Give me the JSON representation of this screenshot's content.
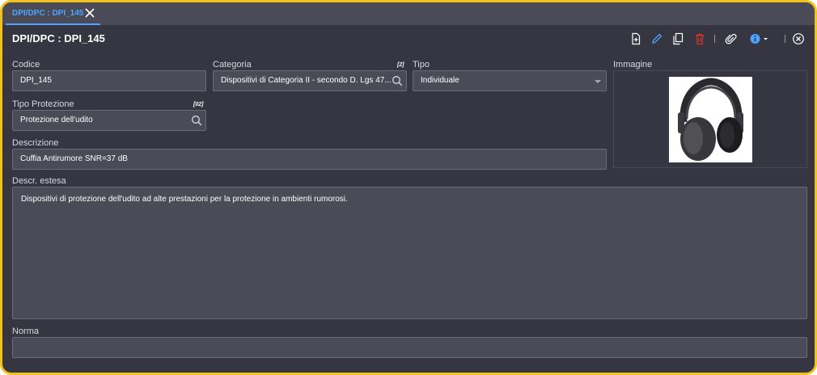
{
  "tab": {
    "label": "DPI/DPC : DPI_145"
  },
  "header": {
    "title": "DPI/DPC : DPI_145"
  },
  "toolbar": {
    "icons": [
      "new-document-icon",
      "edit-pencil-icon",
      "copy-icon",
      "delete-trash-icon",
      "attachment-icon",
      "info-icon",
      "close-circle-icon"
    ],
    "colors": {
      "edit": "#4da3ff",
      "delete": "#d9342b",
      "info": "#4da3ff"
    }
  },
  "form": {
    "codice": {
      "label": "Codice",
      "value": "DPI_145"
    },
    "categoria": {
      "label": "Categoria",
      "tag": "[2]",
      "value": "Dispositivi di Categoria II - secondo D. Lgs 47..."
    },
    "tipo": {
      "label": "Tipo",
      "value": "Individuale"
    },
    "immagine": {
      "label": "Immagine",
      "image": "ear-muffs-headphones"
    },
    "tipo_protezione": {
      "label": "Tipo Protezione",
      "tag": "[02]",
      "value": "Protezione dell'udito"
    },
    "descrizione": {
      "label": "Descrizione",
      "value": "Cuffia Antirumore SNR=37 dB"
    },
    "descr_estesa": {
      "label": "Descr. estesa",
      "value": "Dispositivi di protezione dell'udito ad alte prestazioni per la protezione in ambienti  rumorosi."
    },
    "norma": {
      "label": "Norma",
      "value": ""
    }
  },
  "colors": {
    "frame_border": "#f2c21b",
    "background": "#353641",
    "field": "#4a4b57",
    "accent": "#4da3ff"
  }
}
